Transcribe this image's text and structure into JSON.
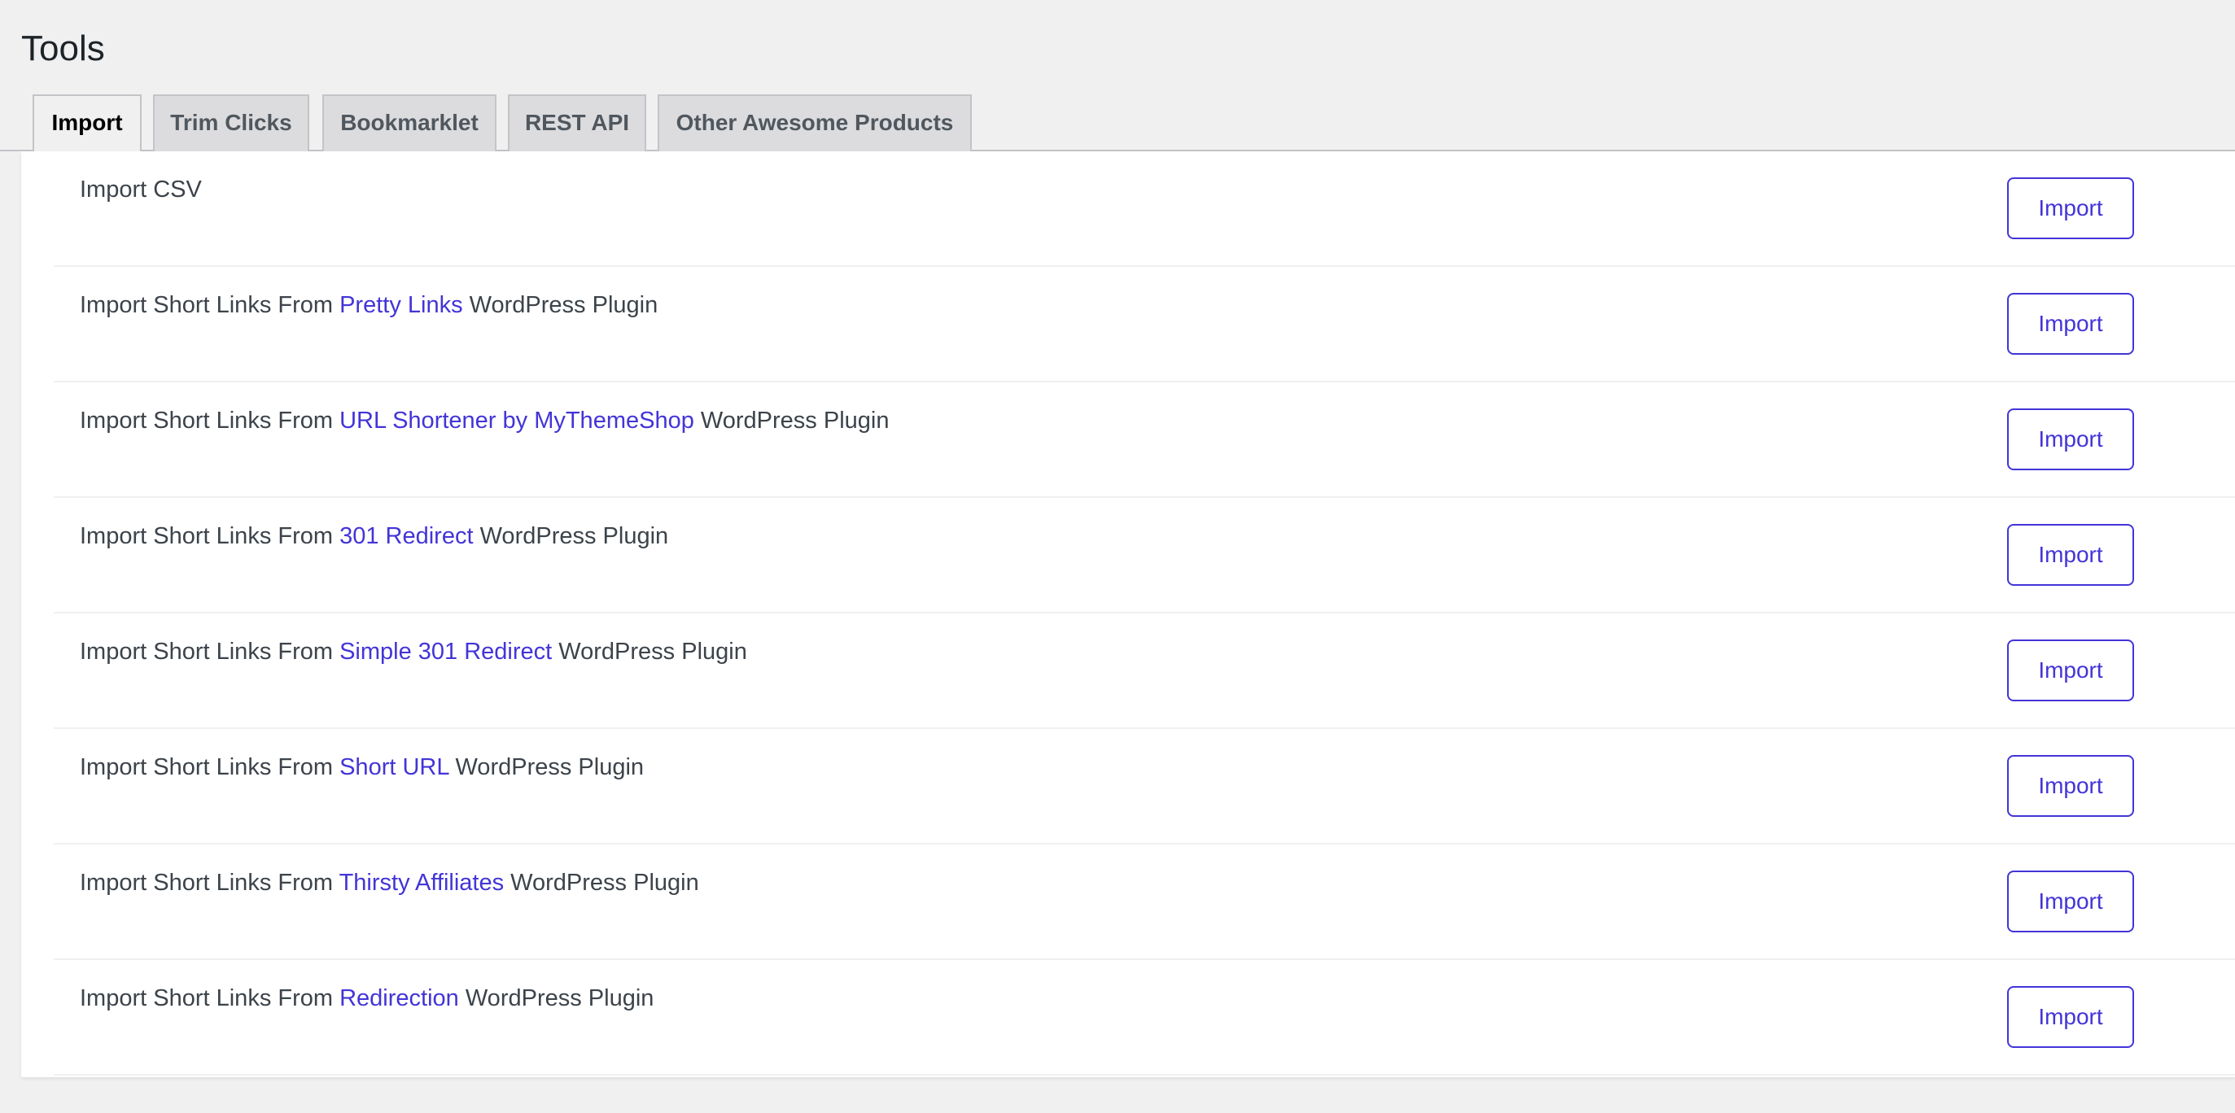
{
  "page": {
    "title": "Tools"
  },
  "tabs": [
    {
      "label": "Import",
      "active": true
    },
    {
      "label": "Trim Clicks",
      "active": false
    },
    {
      "label": "Bookmarklet",
      "active": false
    },
    {
      "label": "REST API",
      "active": false
    },
    {
      "label": "Other Awesome Products",
      "active": false
    }
  ],
  "colors": {
    "accent": "#4334d8",
    "background": "#f0f0f1",
    "panel": "#ffffff",
    "text": "#3c434a"
  },
  "import_rows": [
    {
      "prefix": "Import CSV",
      "link": "",
      "suffix": "",
      "button": "Import"
    },
    {
      "prefix": "Import Short Links From ",
      "link": "Pretty Links",
      "suffix": " WordPress Plugin",
      "button": "Import"
    },
    {
      "prefix": "Import Short Links From ",
      "link": "URL Shortener by MyThemeShop",
      "suffix": " WordPress Plugin",
      "button": "Import"
    },
    {
      "prefix": "Import Short Links From ",
      "link": "301 Redirect",
      "suffix": " WordPress Plugin",
      "button": "Import"
    },
    {
      "prefix": "Import Short Links From ",
      "link": "Simple 301 Redirect",
      "suffix": " WordPress Plugin",
      "button": "Import"
    },
    {
      "prefix": "Import Short Links From ",
      "link": "Short URL",
      "suffix": " WordPress Plugin",
      "button": "Import"
    },
    {
      "prefix": "Import Short Links From ",
      "link": "Thirsty Affiliates",
      "suffix": " WordPress Plugin",
      "button": "Import"
    },
    {
      "prefix": "Import Short Links From ",
      "link": "Redirection",
      "suffix": " WordPress Plugin",
      "button": "Import"
    }
  ]
}
